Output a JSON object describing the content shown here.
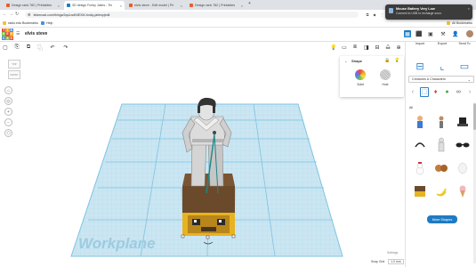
{
  "browser": {
    "tabs": [
      {
        "label": "Design rank 782 | Printables"
      },
      {
        "label": "3D design Funky Jailes - Tin"
      },
      {
        "label": "elvis steve - Edit model | Pri"
      },
      {
        "label": "Design rank 782 | Printables"
      }
    ],
    "url": "tinkercad.com/things/2quLwdNIEXM-funky-jailesp|edit",
    "bookmarks": [
      {
        "label": "radio.edu Bookmarks"
      },
      {
        "label": "Help"
      }
    ],
    "all_bookmarks": "All Bookmarks"
  },
  "notification": {
    "title": "Mouse Battery Very Low",
    "body": "Connect to USB to recharge soon."
  },
  "app": {
    "logo_letters": [
      "T",
      "I",
      "N",
      "K",
      "E",
      "R",
      "C",
      "A",
      "D"
    ],
    "design_name": "elvis steve"
  },
  "right_panel": {
    "tools": [
      {
        "label": "Import"
      },
      {
        "label": "Export"
      },
      {
        "label": "Send To"
      }
    ],
    "category": "Creatures & Characters",
    "all_label": "All",
    "more_shapes": "More Shapes"
  },
  "inspector": {
    "title": "Shape",
    "solid_label": "Solid",
    "hole_label": "Hole"
  },
  "viewport": {
    "viewcube_top": "TOP",
    "viewcube_front": "FRONT",
    "workplane_label": "Workplane",
    "settings_label": "Settings",
    "snap_grid_label": "Snap Grid",
    "snap_grid_value": "1.0 mm"
  },
  "colors": {
    "accent": "#1e7bc4",
    "grid_fill": "#cbe6f2",
    "grid_line": "#7ec3e0",
    "box_brown": "#6b4a2b",
    "box_yellow": "#e7b321"
  }
}
